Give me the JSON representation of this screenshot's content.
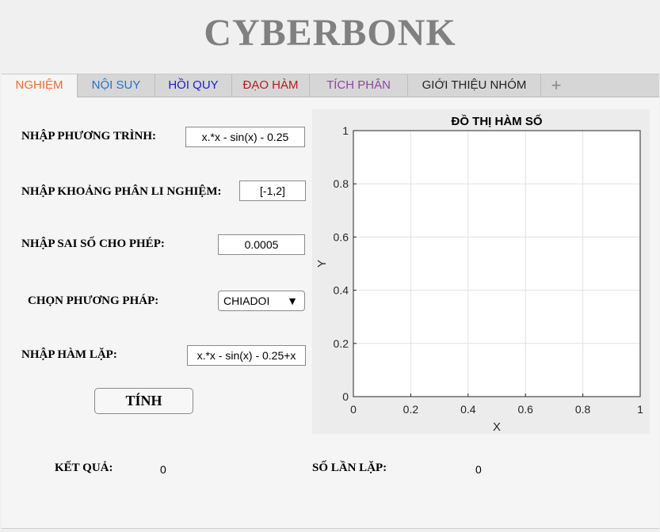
{
  "app": {
    "title": "CYBERBONK"
  },
  "tabs": [
    {
      "label": "NGHIỆM",
      "color": "#f26b2d",
      "active": true
    },
    {
      "label": "NỘI SUY",
      "color": "#2a6fd1",
      "active": false
    },
    {
      "label": "HỒI QUY",
      "color": "#1c1ccf",
      "active": false
    },
    {
      "label": "ĐẠO HÀM",
      "color": "#b21c1c",
      "active": false
    },
    {
      "label": "TÍCH PHÂN",
      "color": "#8e44ad",
      "active": false
    },
    {
      "label": "GIỚI THIỆU NHÓM",
      "color": "#222222",
      "active": false
    }
  ],
  "add_tab_symbol": "+",
  "form": {
    "equation_label": "NHẬP PHƯƠNG TRÌNH:",
    "equation_value": "x.*x - sin(x) - 0.25",
    "interval_label": "NHẬP KHOẢNG PHÂN LI NGHIỆM:",
    "interval_value": "[-1,2]",
    "tolerance_label": "NHẬP SAI SỐ CHO PHÉP:",
    "tolerance_value": "0.0005",
    "method_label": "CHỌN PHƯƠNG PHÁP:",
    "method_value": "CHIADOI",
    "iteration_func_label": "NHẬP HÀM LẶP:",
    "iteration_func_value": "x.*x - sin(x) - 0.25+x",
    "compute_button": "TÍNH"
  },
  "results": {
    "result_label": "KẾT QUẢ:",
    "result_value": "0",
    "iterations_label": "SỐ LẦN LẶP:",
    "iterations_value": "0"
  },
  "chart_data": {
    "type": "line",
    "title": "ĐỒ THỊ HÀM SỐ",
    "xlabel": "X",
    "ylabel": "Y",
    "xlim": [
      0,
      1
    ],
    "ylim": [
      0,
      1
    ],
    "xticks": [
      "0",
      "0.2",
      "0.4",
      "0.6",
      "0.8",
      "1"
    ],
    "yticks": [
      "0",
      "0.2",
      "0.4",
      "0.6",
      "0.8",
      "1"
    ],
    "grid": true,
    "series": []
  }
}
